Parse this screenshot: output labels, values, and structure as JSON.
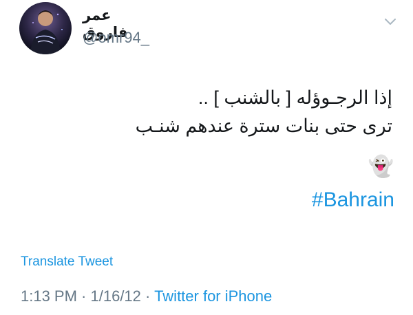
{
  "author": {
    "display_name": "عمر فاروق",
    "handle": "@omr94_"
  },
  "tweet": {
    "lines": [
      "إذا الرجـوؤله [ بالشنب ] ..",
      "ترى حتى بنات سترة عندهم شنـب"
    ],
    "emoji": "👻",
    "hashtag": "#Bahrain"
  },
  "actions": {
    "translate_label": "Translate Tweet",
    "menu_icon": "chevron-down-icon"
  },
  "meta": {
    "time": "1:13 PM",
    "separator": " · ",
    "date": "1/16/12",
    "source": "Twitter for iPhone"
  },
  "colors": {
    "link": "#1b95e0",
    "secondary_text": "#657786",
    "primary_text": "#14171a"
  }
}
